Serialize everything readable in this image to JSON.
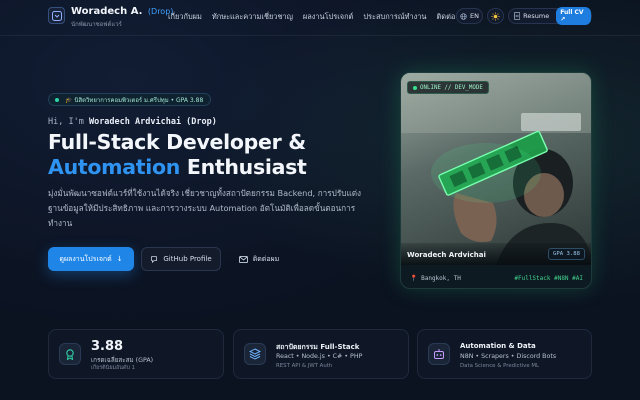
{
  "nav": {
    "brand_name": "Woradech A.",
    "brand_tag": "(Drop)",
    "brand_subtitle": "นักพัฒนาซอฟต์แวร์",
    "links": [
      "เกี่ยวกับผม",
      "ทักษะและความเชี่ยวชาญ",
      "ผลงานโปรเจกต์",
      "ประสบการณ์ทำงาน",
      "ติดต่อ"
    ],
    "lang_label": "EN",
    "resume_label": "Resume",
    "fullcv_label": "Full CV"
  },
  "hero": {
    "badge": "🎓 นิสิตวิทยาการคอมพิวเตอร์ ม.ศรีปทุม • GPA 3.88",
    "greeting_prefix": "Hi, I'm ",
    "greeting_name": "Woradech Ardvichai (Drop)",
    "title_line1": "Full-Stack Developer &",
    "title_accent": "Automation",
    "title_rest": " Enthusiast",
    "description": "มุ่งมั่นพัฒนาซอฟต์แวร์ที่ใช้งานได้จริง เชี่ยวชาญทั้งสถาปัตยกรรม Backend, การปรับแต่งฐานข้อมูลให้มีประสิทธิภาพ และการวางระบบ Automation อัตโนมัติเพื่อลดขั้นตอนการทำงาน",
    "btn_projects": "ดูผลงานโปรเจกต์",
    "btn_github": "GitHub Profile",
    "btn_contact": "ติดต่อผม"
  },
  "profile_card": {
    "status": "ONLINE // DEV_MODE",
    "name": "Woradech Ardvichai",
    "gpa": "GPA 3.88",
    "location": "Bangkok, TH",
    "tags": "#FullStack #N8N #AI"
  },
  "stats": [
    {
      "value": "3.88",
      "line1": "เกรดเฉลี่ยสะสม (GPA)",
      "line2": "เกียรตินิยมอันดับ 1"
    },
    {
      "title": "สถาปัตยกรรม Full-Stack",
      "line1": "React • Node.js • C# • PHP",
      "line2": "REST API & JWT Auth"
    },
    {
      "title": "Automation & Data",
      "line1": "N8N • Scrapers • Discord Bots",
      "line2": "Data Science & Predictive ML"
    }
  ],
  "colors": {
    "accent": "#2f93f1",
    "success": "#35e08b",
    "background": "#0b1220"
  }
}
